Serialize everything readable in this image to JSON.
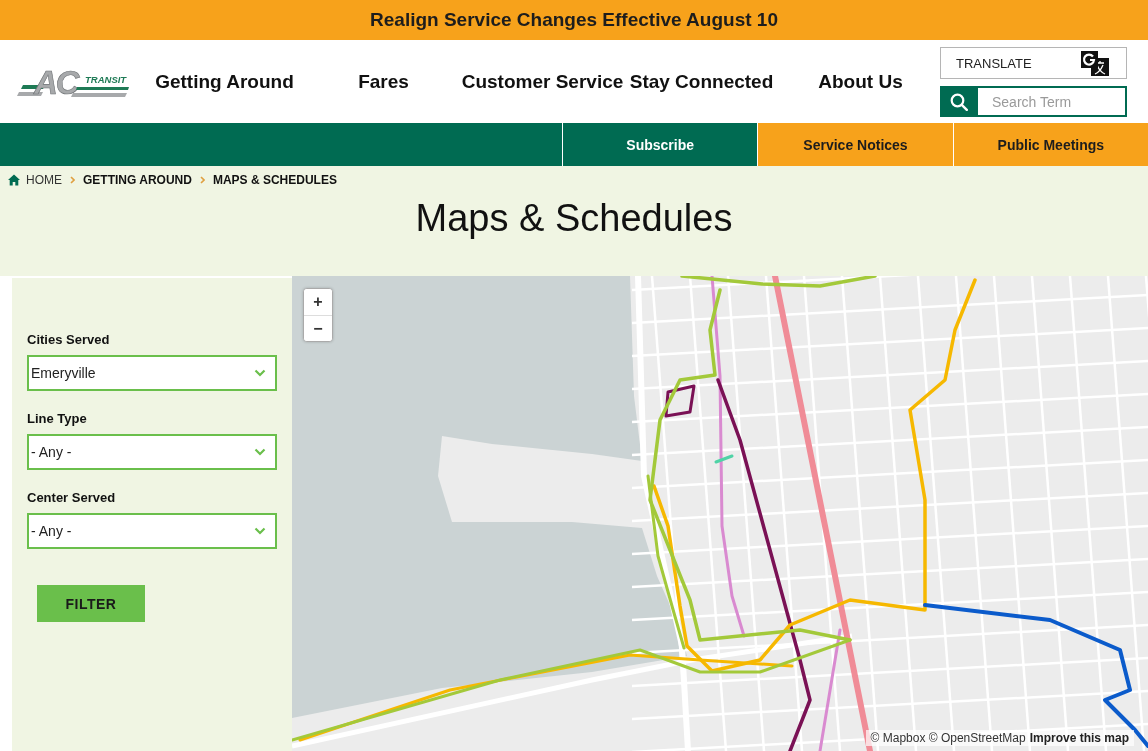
{
  "banner": {
    "text": "Realign Service Changes Effective August 10"
  },
  "header": {
    "logo": {
      "letters": "AC",
      "tagline": "TRANSIT"
    },
    "nav": [
      "Getting Around",
      "Fares",
      "Customer Service",
      "Stay Connected",
      "About Us"
    ],
    "translate": {
      "label": "TRANSLATE"
    },
    "search": {
      "placeholder": "Search Term"
    }
  },
  "quick_links": [
    {
      "label": "Subscribe",
      "kind": "primary"
    },
    {
      "label": "Service Notices",
      "kind": "accent"
    },
    {
      "label": "Public Meetings",
      "kind": "accent"
    }
  ],
  "breadcrumb": [
    {
      "label": "HOME",
      "kind": "home"
    },
    {
      "label": "GETTING AROUND",
      "kind": "page"
    },
    {
      "label": "MAPS & SCHEDULES",
      "kind": "page"
    }
  ],
  "page_title": "Maps & Schedules",
  "filters": [
    {
      "label": "Cities Served",
      "value": "Emeryville"
    },
    {
      "label": "Line Type",
      "value": "- Any -"
    },
    {
      "label": "Center Served",
      "value": "- Any -"
    }
  ],
  "filter_button": {
    "label": "FILTER"
  },
  "map": {
    "zoom_in": "+",
    "zoom_out": "−",
    "attribution": "© Mapbox © OpenStreetMap",
    "improve_link": "Improve this map"
  }
}
